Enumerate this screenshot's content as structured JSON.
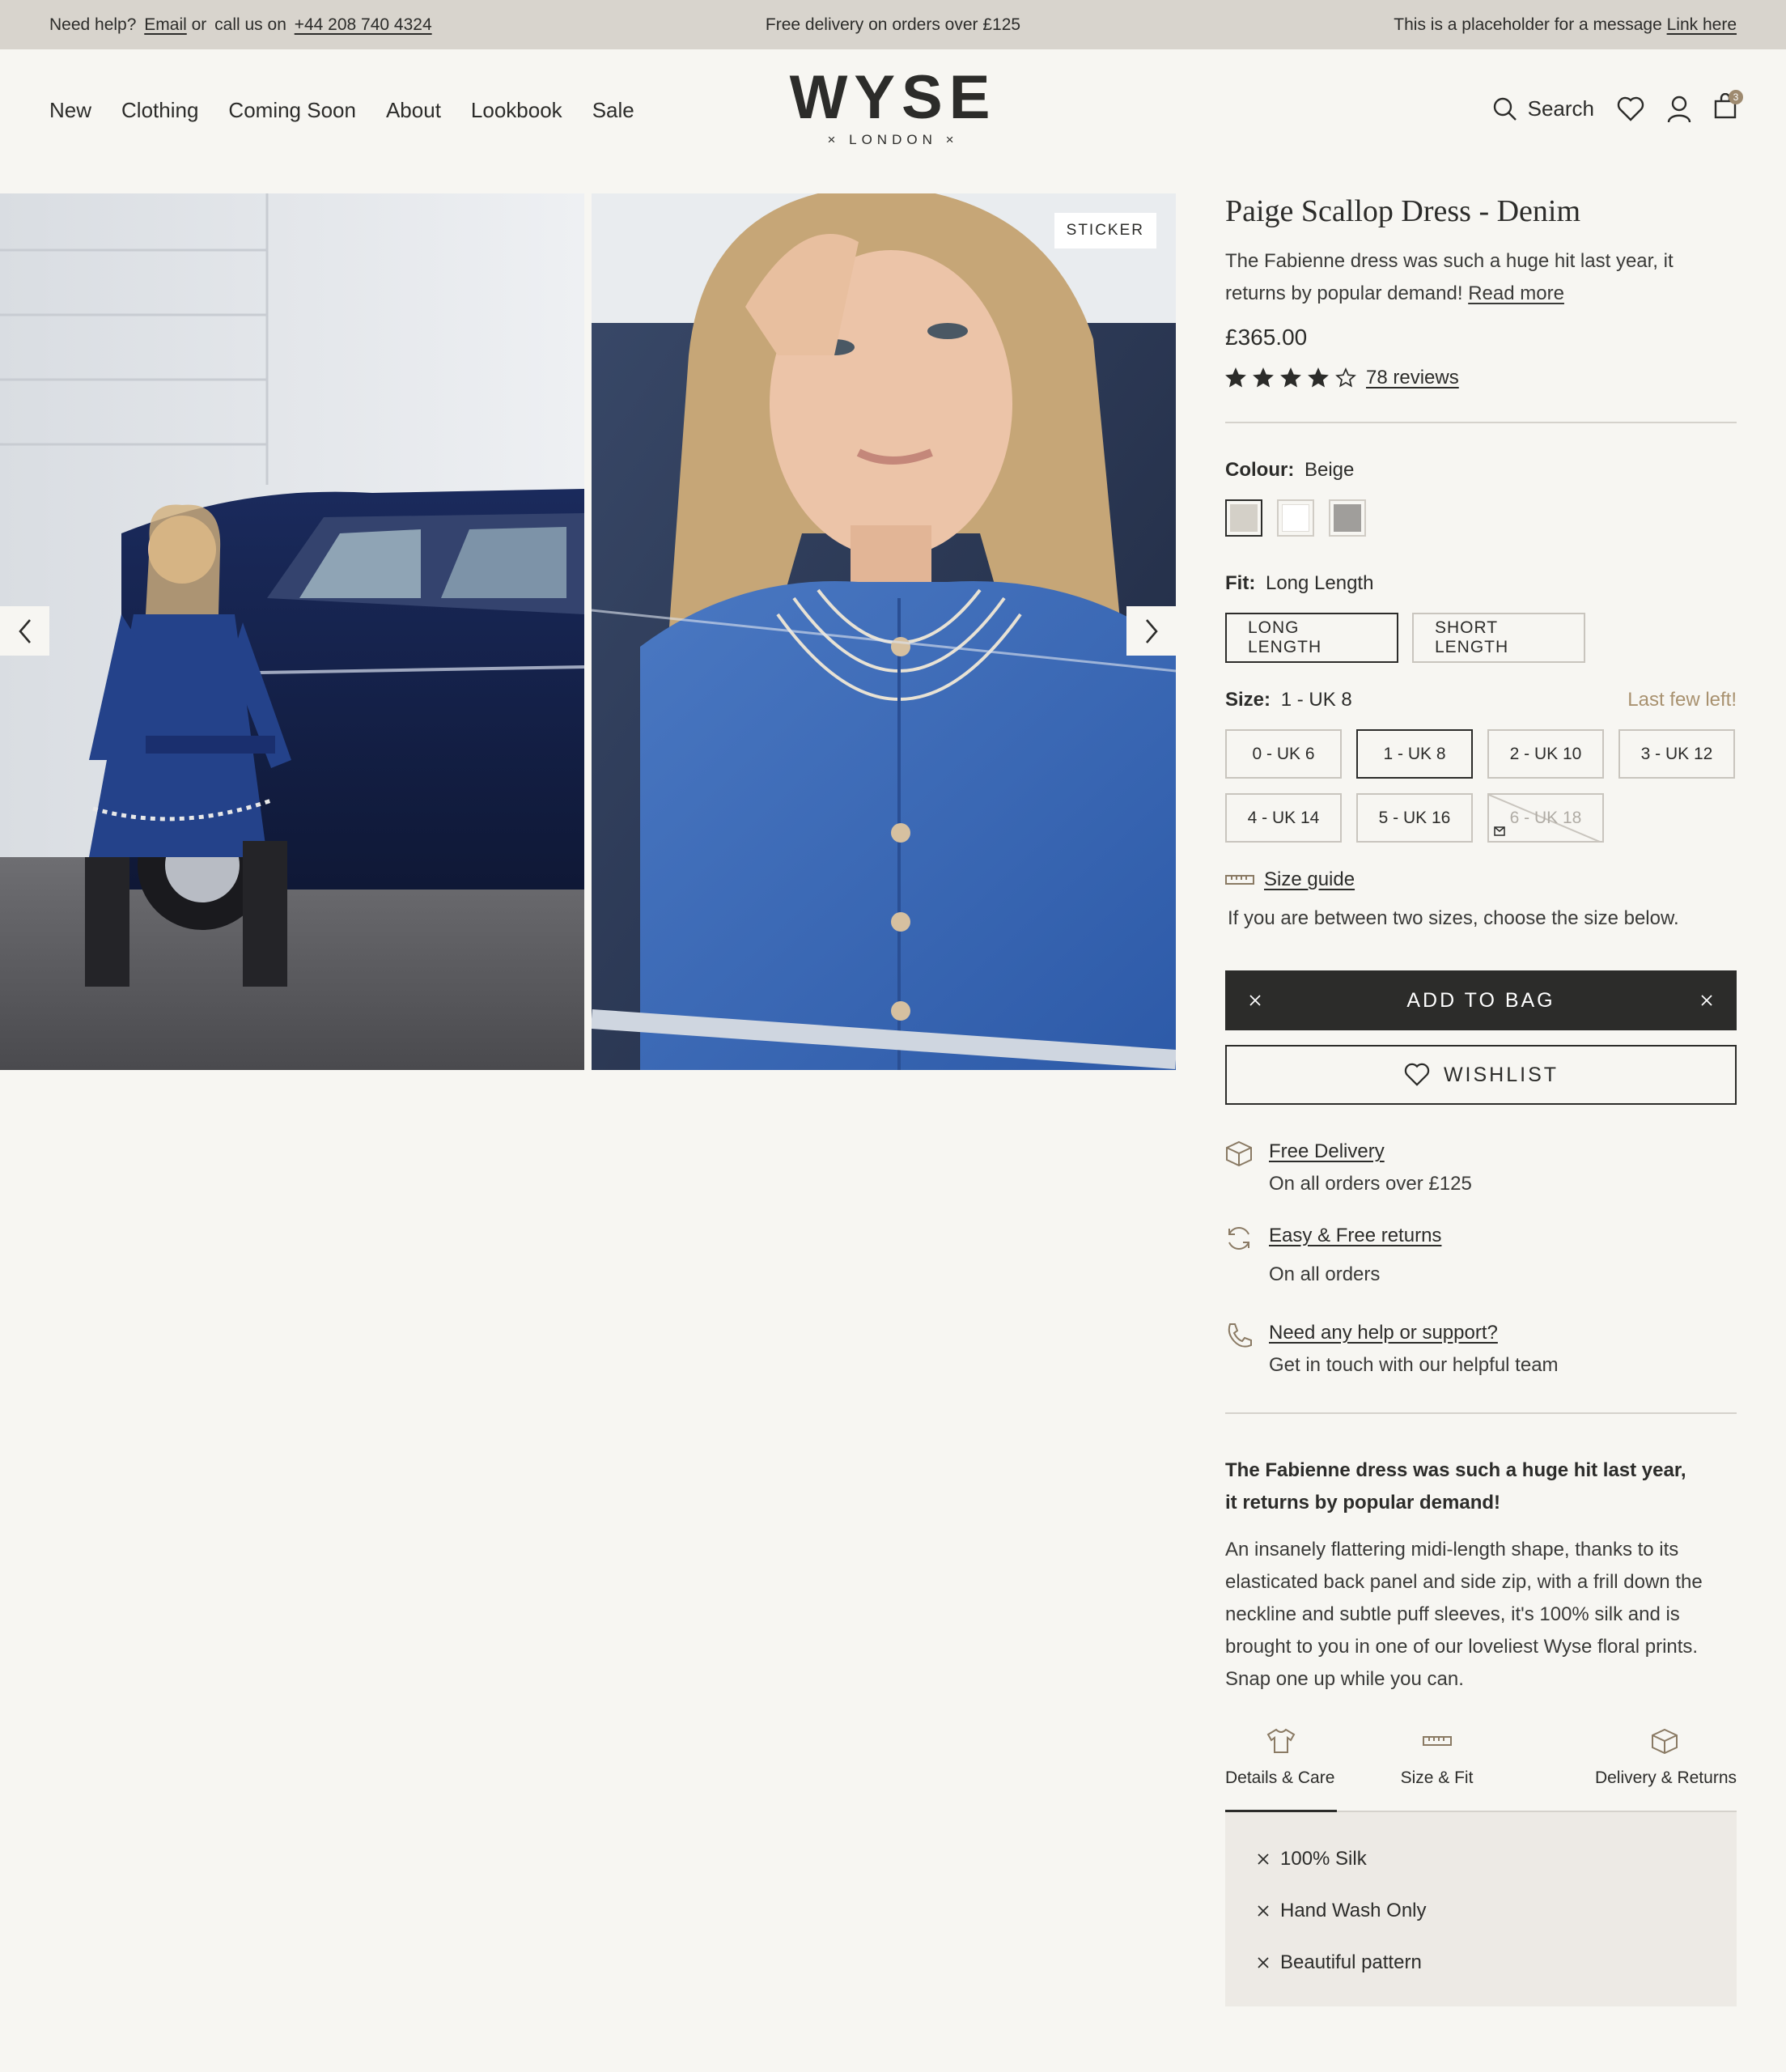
{
  "topbar": {
    "help_prefix": "Need help?",
    "email_label": "Email",
    "or_text": "or",
    "call_text": "call us on",
    "phone": "+44 208 740 4324",
    "center": "Free delivery on orders over £125",
    "right_prefix": "This is a placeholder for a message",
    "right_link": "Link here"
  },
  "nav": [
    "New",
    "Clothing",
    "Coming Soon",
    "About",
    "Lookbook",
    "Sale"
  ],
  "logo": {
    "brand": "WYSE",
    "sub": "× LONDON ×"
  },
  "header_icons": {
    "search_label": "Search",
    "bag_count": "3"
  },
  "gallery": {
    "sticker": "STICKER"
  },
  "product": {
    "title": "Paige Scallop Dress - Denim",
    "lead": "The Fabienne dress was such a huge hit last year, it returns by popular demand!",
    "read_more": "Read more",
    "price": "£365.00",
    "rating": 4,
    "rating_max": 5,
    "reviews": "78 reviews",
    "colour_label": "Colour:",
    "colour_value": "Beige",
    "swatches": [
      "#d4d0c8",
      "#ffffff",
      "#a09e9b"
    ],
    "fit_label": "Fit:",
    "fit_value": "Long Length",
    "fits": [
      "LONG  LENGTH",
      "SHORT LENGTH"
    ],
    "size_label": "Size:",
    "size_value": "1 - UK 8",
    "size_note": "Last few left!",
    "sizes": [
      "0 - UK 6",
      "1 - UK 8",
      "2 - UK 10",
      "3 - UK 12",
      "4 - UK 14",
      "5 - UK 16",
      "6 - UK 18"
    ],
    "size_guide": "Size guide",
    "size_hint": "If you are between two sizes, choose the size below.",
    "add_to_bag": "ADD TO BAG",
    "wishlist": "WISHLIST",
    "features": [
      {
        "title": "Free Delivery",
        "sub": "On all orders over £125"
      },
      {
        "title": "Easy & Free returns",
        "sub": "On all orders"
      },
      {
        "title": "Need any help or support?",
        "sub": "Get in touch with our helpful team"
      }
    ],
    "desc_bold": "The Fabienne dress was such a huge hit last year, it returns by popular demand!",
    "desc": "An insanely flattering midi-length shape, thanks to its elasticated back panel and side zip, with a frill down the neckline and subtle puff sleeves, it's 100% silk and is brought to you in one of our loveliest Wyse floral prints. Snap one up while you can.",
    "tabs": [
      "Details & Care",
      "Size & Fit",
      "Delivery & Returns"
    ],
    "details": [
      "100% Silk",
      "Hand Wash Only",
      "Beautiful pattern"
    ]
  },
  "colors": {
    "topbar": "#d8d4cd",
    "page": "#f7f6f2",
    "dark": "#2c2c2a",
    "accent": "#a8916f"
  }
}
